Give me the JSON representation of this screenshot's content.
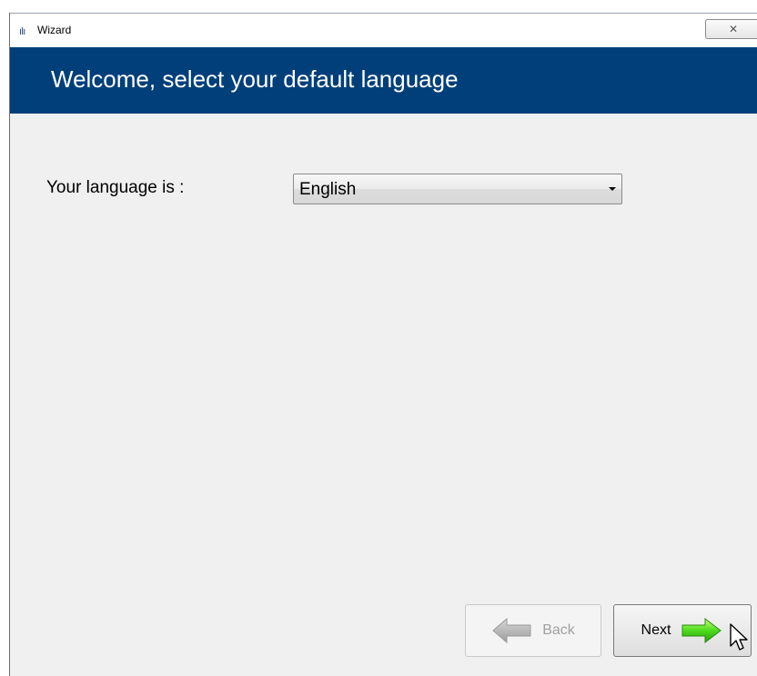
{
  "window": {
    "title": "Wizard",
    "app_icon": "ıIı",
    "close_glyph": "✕"
  },
  "header": {
    "title": "Welcome, select your default language"
  },
  "language": {
    "label": "Your language is :",
    "selected": "English"
  },
  "buttons": {
    "back_label": "Back",
    "back_enabled": false,
    "next_label": "Next"
  },
  "icons": {
    "app": "app-logo-icon",
    "close": "close-icon",
    "dropdown": "chevron-down-icon",
    "back": "arrow-left-icon",
    "next": "arrow-right-icon",
    "cursor": "mouse-cursor-icon"
  },
  "colors": {
    "header_bg": "#003f7a",
    "window_bg": "#f0f0f0",
    "next_arrow": "#4cdc1c",
    "back_arrow": "#b0b0b0"
  }
}
